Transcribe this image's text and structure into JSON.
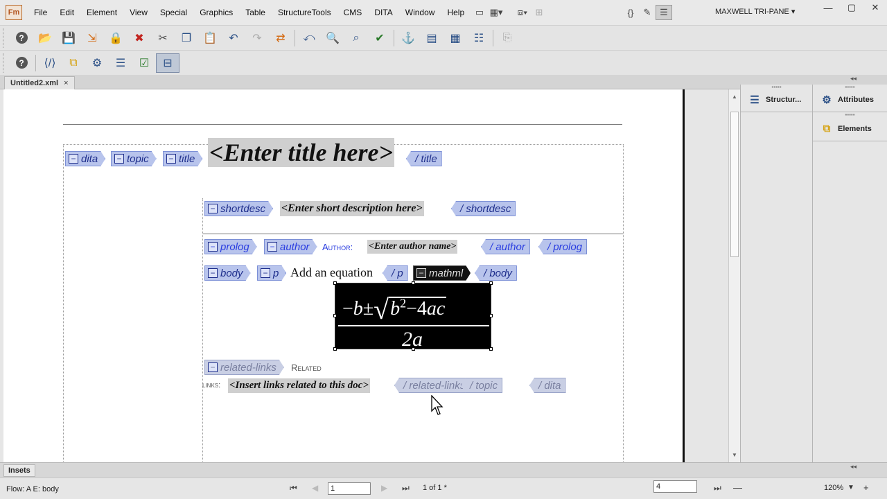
{
  "app": {
    "logo": "Fm",
    "menu": [
      "File",
      "Edit",
      "Element",
      "View",
      "Special",
      "Graphics",
      "Table",
      "StructureTools",
      "CMS",
      "DITA",
      "Window",
      "Help"
    ],
    "workspace": "MAXWELL TRI-PANE",
    "window_buttons": [
      "minimize",
      "restore",
      "close"
    ]
  },
  "toolbar_primary": {
    "icons": [
      "help-icon",
      "open-folder-icon",
      "save-icon",
      "import-icon",
      "lock-icon",
      "delete-icon",
      "cut-icon",
      "copy-icon",
      "paste-icon",
      "undo-icon",
      "redo-icon",
      "insert-icon",
      "spell-icon",
      "find-icon",
      "zoom-icon",
      "check-spelling-icon",
      "anchor-icon",
      "text-frame-icon",
      "table-icon",
      "list-icon",
      "disabled-icon"
    ]
  },
  "toolbar_structure": {
    "icons": [
      "help-icon",
      "xml-view-icon",
      "insert-element-icon",
      "attributes-icon",
      "structure-icon",
      "validate-icon",
      "tag-view-icon"
    ]
  },
  "document": {
    "tab_name": "Untitled2.xml",
    "tab_close": "×",
    "elements": {
      "dita": "dita",
      "topic": "topic",
      "title": "title",
      "title_placeholder": "<Enter title here>",
      "title_end": "/ title",
      "shortdesc": "shortdesc",
      "shortdesc_placeholder": "<Enter short description here>",
      "shortdesc_end": "/ shortdesc",
      "prolog": "prolog",
      "author": "author",
      "author_prefix": "Author:",
      "author_placeholder": "<Enter author name>",
      "author_end": "/ author",
      "prolog_end": "/ prolog",
      "body": "body",
      "p": "p",
      "p_text": "Add an equation",
      "p_end": "/ p",
      "mathml": "mathml",
      "body_end": "/ body",
      "related_links": "related-links",
      "related_prefix_1": "Related",
      "related_prefix_2": "links:",
      "related_placeholder": "<Insert links related to this doc>",
      "related_links_end": "/ related-links",
      "topic_end": "/ topic",
      "dita_end": "/ dita"
    },
    "equation": {
      "numerator": "−b ± √ b² − 4ac",
      "minus": "−",
      "b": "b",
      "pm": "±",
      "sqrt": "√",
      "b_sq": "b",
      "exp": "2",
      "minus2": "−",
      "four_ac": "4ac",
      "denominator": "2a"
    }
  },
  "panels": {
    "col1": [
      {
        "label": "Structur...",
        "icon": "structure-icon"
      }
    ],
    "col2": [
      {
        "label": "Attributes",
        "icon": "attributes-icon"
      },
      {
        "label": "Elements",
        "icon": "elements-icon"
      }
    ]
  },
  "bottom": {
    "insets_tab": "Insets",
    "flow_status": "Flow: A   E: body",
    "page_input": "1",
    "page_of": "1 of 1 *",
    "zoom_field": "4",
    "zoom": "120%"
  }
}
